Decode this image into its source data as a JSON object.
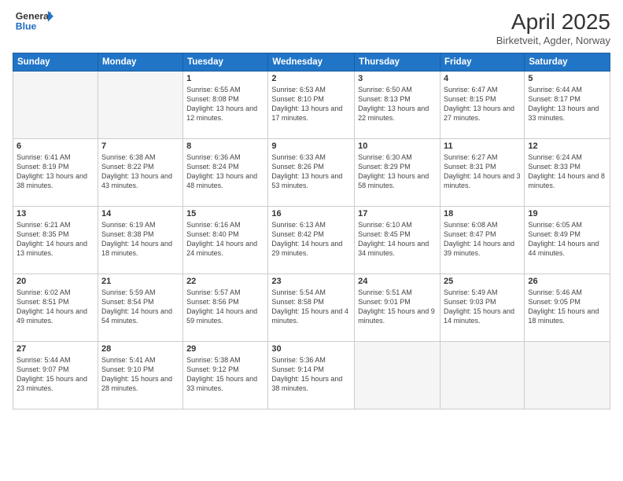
{
  "header": {
    "logo_general": "General",
    "logo_blue": "Blue",
    "title": "April 2025",
    "location": "Birketveit, Agder, Norway"
  },
  "days_of_week": [
    "Sunday",
    "Monday",
    "Tuesday",
    "Wednesday",
    "Thursday",
    "Friday",
    "Saturday"
  ],
  "weeks": [
    [
      {
        "day": "",
        "detail": ""
      },
      {
        "day": "",
        "detail": ""
      },
      {
        "day": "1",
        "detail": "Sunrise: 6:55 AM\nSunset: 8:08 PM\nDaylight: 13 hours and 12 minutes."
      },
      {
        "day": "2",
        "detail": "Sunrise: 6:53 AM\nSunset: 8:10 PM\nDaylight: 13 hours and 17 minutes."
      },
      {
        "day": "3",
        "detail": "Sunrise: 6:50 AM\nSunset: 8:13 PM\nDaylight: 13 hours and 22 minutes."
      },
      {
        "day": "4",
        "detail": "Sunrise: 6:47 AM\nSunset: 8:15 PM\nDaylight: 13 hours and 27 minutes."
      },
      {
        "day": "5",
        "detail": "Sunrise: 6:44 AM\nSunset: 8:17 PM\nDaylight: 13 hours and 33 minutes."
      }
    ],
    [
      {
        "day": "6",
        "detail": "Sunrise: 6:41 AM\nSunset: 8:19 PM\nDaylight: 13 hours and 38 minutes."
      },
      {
        "day": "7",
        "detail": "Sunrise: 6:38 AM\nSunset: 8:22 PM\nDaylight: 13 hours and 43 minutes."
      },
      {
        "day": "8",
        "detail": "Sunrise: 6:36 AM\nSunset: 8:24 PM\nDaylight: 13 hours and 48 minutes."
      },
      {
        "day": "9",
        "detail": "Sunrise: 6:33 AM\nSunset: 8:26 PM\nDaylight: 13 hours and 53 minutes."
      },
      {
        "day": "10",
        "detail": "Sunrise: 6:30 AM\nSunset: 8:29 PM\nDaylight: 13 hours and 58 minutes."
      },
      {
        "day": "11",
        "detail": "Sunrise: 6:27 AM\nSunset: 8:31 PM\nDaylight: 14 hours and 3 minutes."
      },
      {
        "day": "12",
        "detail": "Sunrise: 6:24 AM\nSunset: 8:33 PM\nDaylight: 14 hours and 8 minutes."
      }
    ],
    [
      {
        "day": "13",
        "detail": "Sunrise: 6:21 AM\nSunset: 8:35 PM\nDaylight: 14 hours and 13 minutes."
      },
      {
        "day": "14",
        "detail": "Sunrise: 6:19 AM\nSunset: 8:38 PM\nDaylight: 14 hours and 18 minutes."
      },
      {
        "day": "15",
        "detail": "Sunrise: 6:16 AM\nSunset: 8:40 PM\nDaylight: 14 hours and 24 minutes."
      },
      {
        "day": "16",
        "detail": "Sunrise: 6:13 AM\nSunset: 8:42 PM\nDaylight: 14 hours and 29 minutes."
      },
      {
        "day": "17",
        "detail": "Sunrise: 6:10 AM\nSunset: 8:45 PM\nDaylight: 14 hours and 34 minutes."
      },
      {
        "day": "18",
        "detail": "Sunrise: 6:08 AM\nSunset: 8:47 PM\nDaylight: 14 hours and 39 minutes."
      },
      {
        "day": "19",
        "detail": "Sunrise: 6:05 AM\nSunset: 8:49 PM\nDaylight: 14 hours and 44 minutes."
      }
    ],
    [
      {
        "day": "20",
        "detail": "Sunrise: 6:02 AM\nSunset: 8:51 PM\nDaylight: 14 hours and 49 minutes."
      },
      {
        "day": "21",
        "detail": "Sunrise: 5:59 AM\nSunset: 8:54 PM\nDaylight: 14 hours and 54 minutes."
      },
      {
        "day": "22",
        "detail": "Sunrise: 5:57 AM\nSunset: 8:56 PM\nDaylight: 14 hours and 59 minutes."
      },
      {
        "day": "23",
        "detail": "Sunrise: 5:54 AM\nSunset: 8:58 PM\nDaylight: 15 hours and 4 minutes."
      },
      {
        "day": "24",
        "detail": "Sunrise: 5:51 AM\nSunset: 9:01 PM\nDaylight: 15 hours and 9 minutes."
      },
      {
        "day": "25",
        "detail": "Sunrise: 5:49 AM\nSunset: 9:03 PM\nDaylight: 15 hours and 14 minutes."
      },
      {
        "day": "26",
        "detail": "Sunrise: 5:46 AM\nSunset: 9:05 PM\nDaylight: 15 hours and 18 minutes."
      }
    ],
    [
      {
        "day": "27",
        "detail": "Sunrise: 5:44 AM\nSunset: 9:07 PM\nDaylight: 15 hours and 23 minutes."
      },
      {
        "day": "28",
        "detail": "Sunrise: 5:41 AM\nSunset: 9:10 PM\nDaylight: 15 hours and 28 minutes."
      },
      {
        "day": "29",
        "detail": "Sunrise: 5:38 AM\nSunset: 9:12 PM\nDaylight: 15 hours and 33 minutes."
      },
      {
        "day": "30",
        "detail": "Sunrise: 5:36 AM\nSunset: 9:14 PM\nDaylight: 15 hours and 38 minutes."
      },
      {
        "day": "",
        "detail": ""
      },
      {
        "day": "",
        "detail": ""
      },
      {
        "day": "",
        "detail": ""
      }
    ]
  ]
}
